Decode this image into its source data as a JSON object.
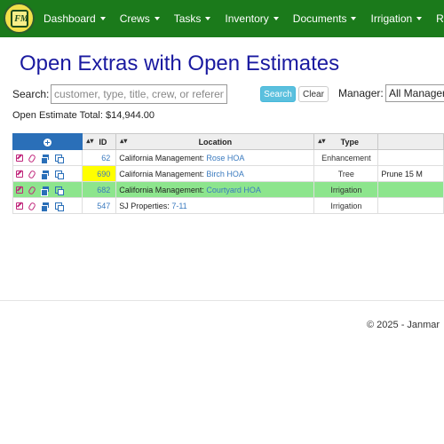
{
  "app": {
    "logo_text": "FM"
  },
  "nav": {
    "items": [
      "Dashboard",
      "Crews",
      "Tasks",
      "Inventory",
      "Documents",
      "Irrigation",
      "Rep"
    ]
  },
  "page": {
    "title": "Open Extras with Open Estimates",
    "search_label": "Search:",
    "search_placeholder": "customer, type, title, crew, or reference",
    "search_value": "",
    "search_button": "Search",
    "clear_button": "Clear",
    "manager_label": "Manager:",
    "manager_value": "All Managers",
    "total_text": "Open Estimate Total: $14,944.00"
  },
  "table": {
    "headers": {
      "id": "ID",
      "location": "Location",
      "type": "Type"
    },
    "rows": [
      {
        "id": "62",
        "customer": "California Management:",
        "site": "Rose HOA",
        "type": "Enhancement",
        "title": ""
      },
      {
        "id": "690",
        "customer": "California Management:",
        "site": "Birch HOA",
        "type": "Tree",
        "title": "Prune 15 M"
      },
      {
        "id": "682",
        "customer": "California Management:",
        "site": "Courtyard HOA",
        "type": "Irrigation",
        "title": ""
      },
      {
        "id": "547",
        "customer": "SJ Properties:",
        "site": "7-11",
        "type": "Irrigation",
        "title": ""
      }
    ]
  },
  "footer": {
    "text": "© 2025 - Janmar"
  },
  "colors": {
    "navbar": "#1b7a1b",
    "title": "#1a1aa0",
    "header_actions": "#2a6fb8",
    "row_highlight": "#8de58d",
    "id_highlight": "#ffff00",
    "link": "#3a7abf"
  }
}
